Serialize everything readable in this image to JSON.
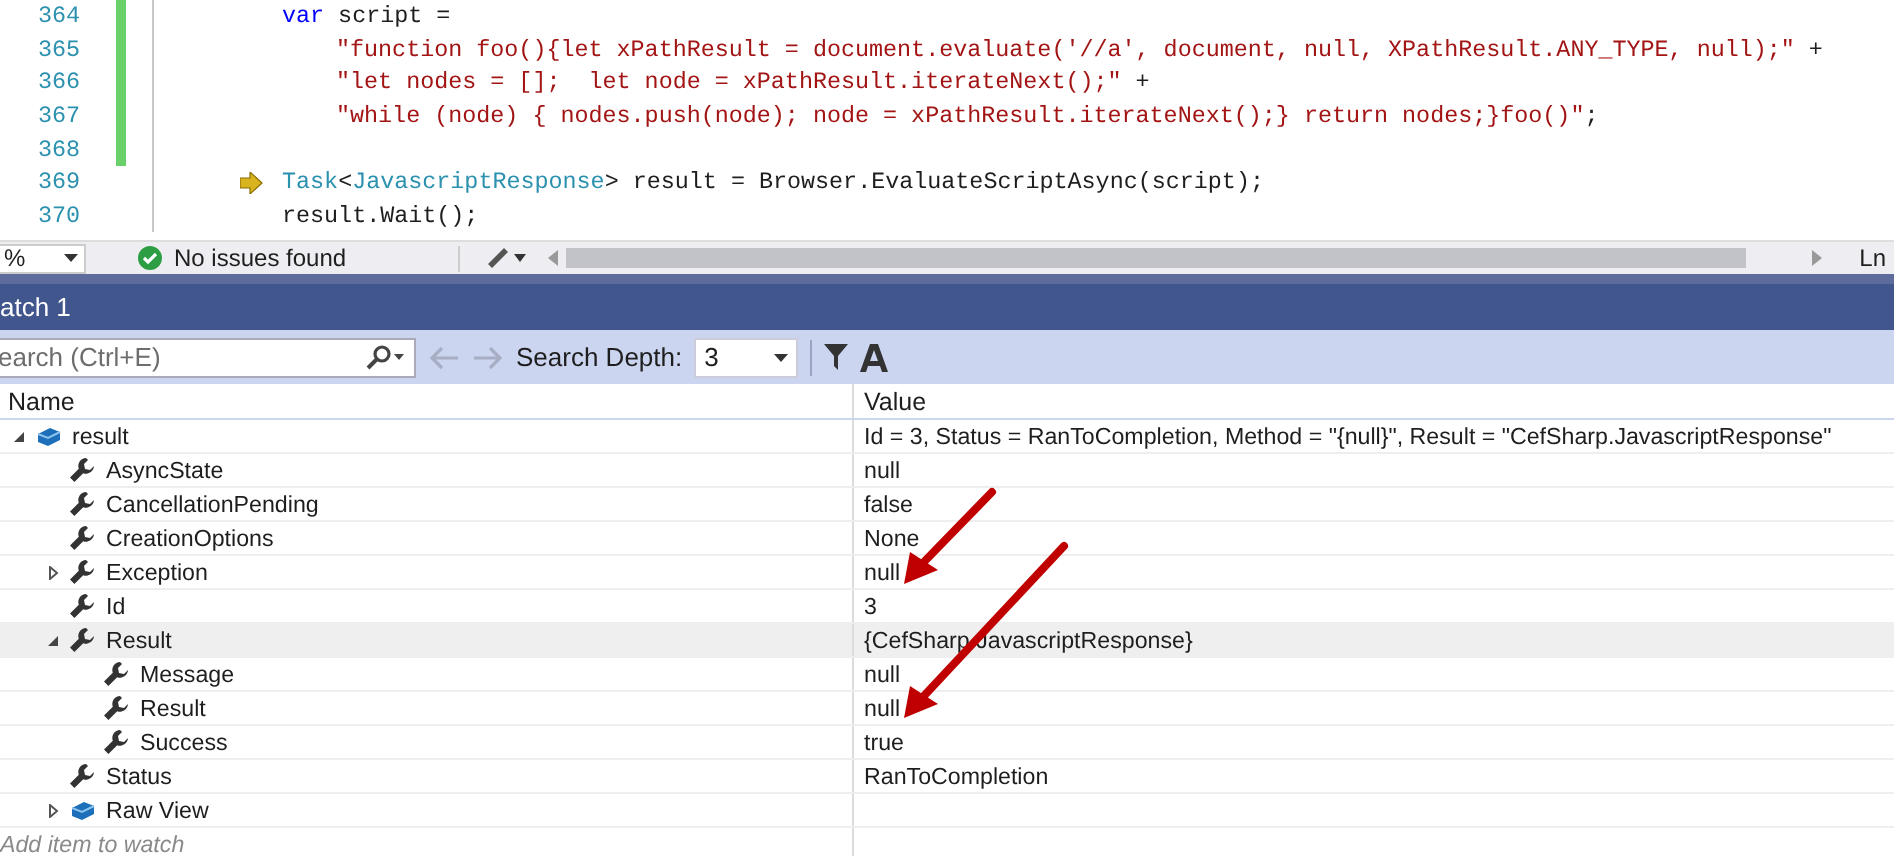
{
  "editor": {
    "lines": [
      {
        "number": "364",
        "changed": true,
        "kind": "code",
        "tokens": [
          {
            "kind": "keyword",
            "text": "var"
          },
          {
            "kind": "plain",
            "text": " script ="
          }
        ]
      },
      {
        "number": "365",
        "changed": true,
        "kind": "continuation",
        "tokens": [
          {
            "kind": "string",
            "text": "\"function foo(){let xPathResult = document.evaluate('//a', document, null, XPathResult.ANY_TYPE, null);\""
          },
          {
            "kind": "plain",
            "text": " +"
          }
        ]
      },
      {
        "number": "366",
        "changed": true,
        "kind": "continuation",
        "tokens": [
          {
            "kind": "string",
            "text": "\"let nodes = [];  let node = xPathResult.iterateNext();\""
          },
          {
            "kind": "plain",
            "text": " +"
          }
        ]
      },
      {
        "number": "367",
        "changed": true,
        "kind": "continuation",
        "tokens": [
          {
            "kind": "string",
            "text": "\"while (node) { nodes.push(node); node = xPathResult.iterateNext();} return nodes;}foo()\""
          },
          {
            "kind": "plain",
            "text": ";"
          }
        ]
      },
      {
        "number": "368",
        "changed": true,
        "kind": "code"
      },
      {
        "number": "369",
        "changed": false,
        "kind": "code",
        "current": true,
        "tokens": [
          {
            "kind": "type",
            "text": "Task"
          },
          {
            "kind": "plain",
            "text": "<"
          },
          {
            "kind": "type",
            "text": "JavascriptResponse"
          },
          {
            "kind": "plain",
            "text": "> result = Browser.EvaluateScriptAsync(script);"
          }
        ]
      },
      {
        "number": "370",
        "changed": false,
        "kind": "code",
        "tokens": [
          {
            "kind": "plain",
            "text": "result.Wait();"
          }
        ]
      }
    ]
  },
  "status_bar": {
    "zoom": "%",
    "issues": "No issues found",
    "position": "Ln"
  },
  "watch": {
    "title": "atch 1",
    "toolbar": {
      "search_placeholder": "earch (Ctrl+E)",
      "depth_label": "Search Depth:",
      "depth_value": "3"
    },
    "columns": [
      "Name",
      "Value"
    ],
    "rows": [
      {
        "name": "result",
        "value": "Id = 3, Status = RanToCompletion, Method = \"{null}\", Result = \"CefSharp.JavascriptResponse\"",
        "kind": "object",
        "expanded": true,
        "selected": false,
        "children": [
          {
            "name": "AsyncState",
            "value": "null",
            "kind": "property",
            "selected": false
          },
          {
            "name": "CancellationPending",
            "value": "false",
            "kind": "property",
            "selected": false
          },
          {
            "name": "CreationOptions",
            "value": "None",
            "kind": "property",
            "selected": false
          },
          {
            "name": "Exception",
            "value": "null",
            "kind": "property",
            "expanded": false,
            "selected": false
          },
          {
            "name": "Id",
            "value": "3",
            "kind": "property",
            "selected": false
          },
          {
            "name": "Result",
            "value": "{CefSharp.JavascriptResponse}",
            "kind": "property",
            "expanded": true,
            "selected": true,
            "children": [
              {
                "name": "Message",
                "value": "null",
                "kind": "property",
                "selected": false
              },
              {
                "name": "Result",
                "value": "null",
                "kind": "property",
                "selected": false
              },
              {
                "name": "Success",
                "value": "true",
                "kind": "property",
                "selected": false
              }
            ]
          },
          {
            "name": "Status",
            "value": "RanToCompletion",
            "kind": "property",
            "selected": false
          },
          {
            "name": "Raw View",
            "kind": "object",
            "expanded": false,
            "selected": false
          }
        ]
      }
    ],
    "add_placeholder": "Add item to watch"
  }
}
